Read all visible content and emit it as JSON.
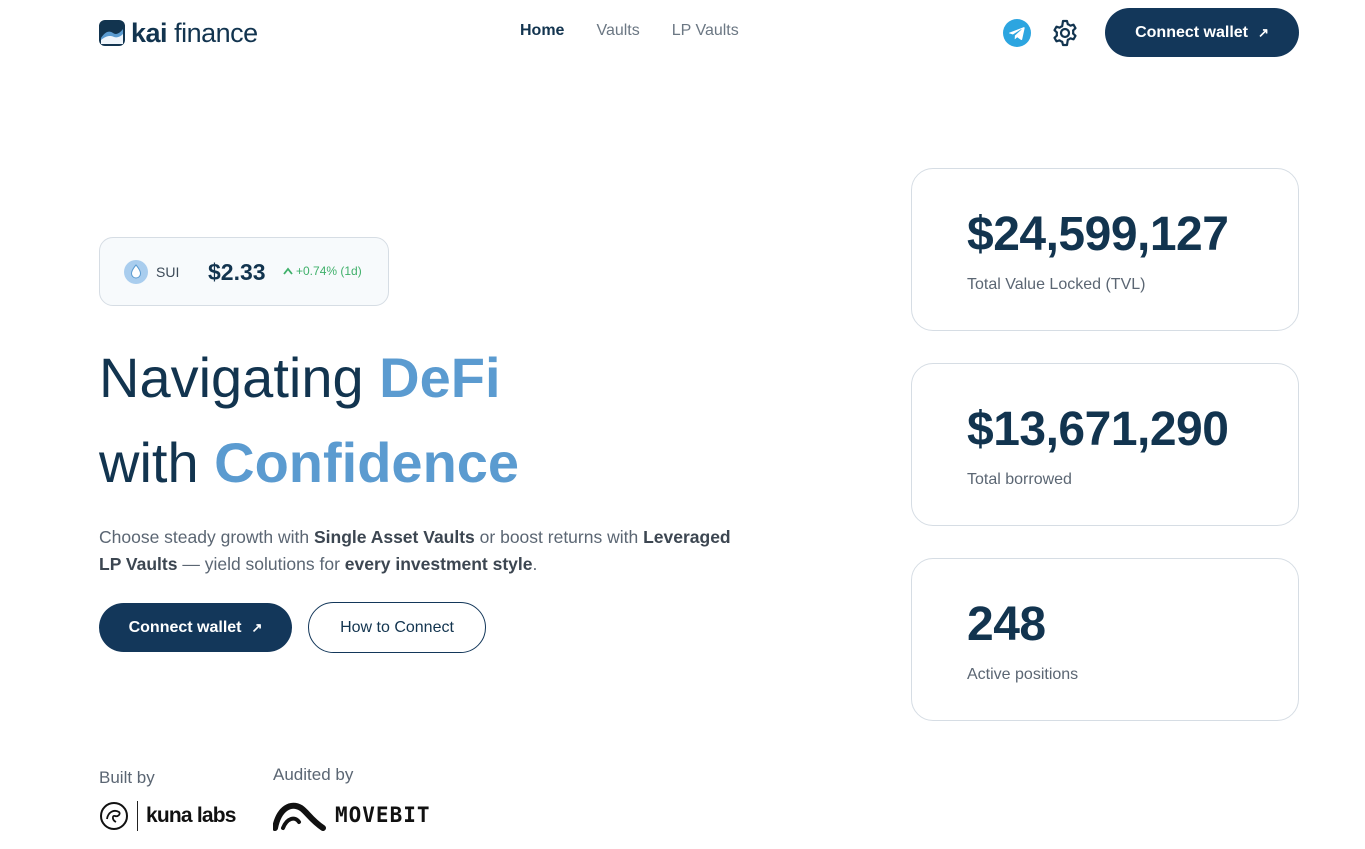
{
  "header": {
    "logo_kai": "kai",
    "logo_finance": "finance",
    "nav": [
      "Home",
      "Vaults",
      "LP Vaults"
    ],
    "connect_label": "Connect wallet",
    "arrow": "↗"
  },
  "ticker": {
    "symbol": "SUI",
    "price": "$2.33",
    "change": "+0.74% (1d)",
    "up_glyph": "^"
  },
  "hero": {
    "line1_plain": "Navigating ",
    "line1_accent": "DeFi",
    "line2_plain": "with ",
    "line2_accent": "Confidence",
    "sub": {
      "t1": "Choose steady growth with ",
      "b1": "Single Asset Vaults",
      "t2": " or boost returns with ",
      "b2": "Leveraged LP Vaults",
      "t3": " — yield solutions for ",
      "b3": "every investment style",
      "t4": "."
    },
    "connect_label": "Connect wallet",
    "how_label": "How to Connect"
  },
  "credits": {
    "built_by": "Built by",
    "builder": "kuna labs",
    "audited_by": "Audited by",
    "auditor": "MOVEBIT"
  },
  "stats": [
    {
      "value": "$24,599,127",
      "label": "Total Value Locked (TVL)"
    },
    {
      "value": "$13,671,290",
      "label": "Total borrowed"
    },
    {
      "value": "248",
      "label": "Active positions"
    }
  ],
  "colors": {
    "primary": "#13375a",
    "accent": "#5b9bd0",
    "positive": "#3fb06a",
    "telegram": "#2ca5e0"
  },
  "icons": [
    "kai-logo-icon",
    "telegram-icon",
    "gear-icon",
    "sui-icon",
    "arrow-up-right-icon",
    "kuna-labs-icon",
    "movebit-icon"
  ]
}
